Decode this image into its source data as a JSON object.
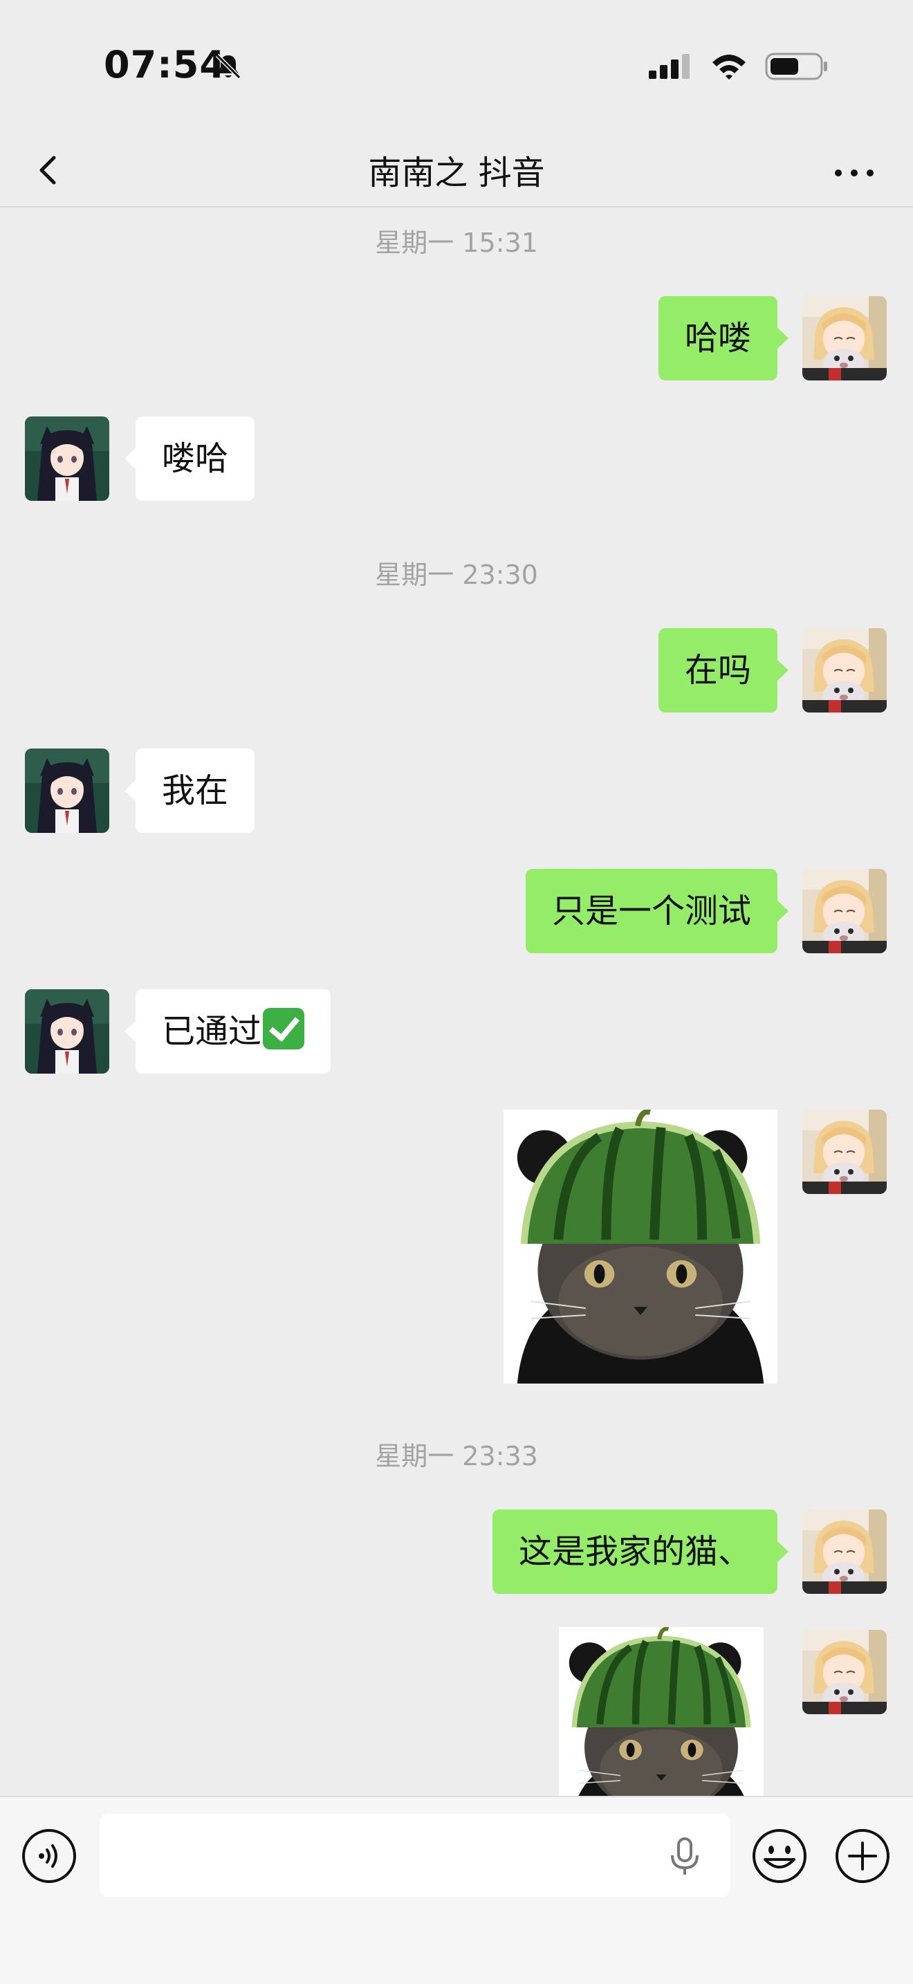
{
  "status_bar": {
    "time": "07:54",
    "icons": [
      "bell-slash-icon",
      "cellular-signal-icon",
      "wifi-icon",
      "battery-icon"
    ]
  },
  "nav": {
    "title": "南南之 抖音",
    "back_icon": "chevron-left-icon",
    "more_icon": "ellipsis-icon"
  },
  "messages": {
    "ts1": "星期一 15:31",
    "m1": "哈喽",
    "m2": "喽哈",
    "ts2": "星期一 23:30",
    "m3": "在吗",
    "m4": "我在",
    "m5": "只是一个测试",
    "m6": "已通过",
    "m6_emoji": "check-mark-button-emoji",
    "ts3": "星期一 23:33",
    "m7": "这是我家的猫、",
    "sticker_desc": "cat-wearing-watermelon-helmet-sticker"
  },
  "input_bar": {
    "voice_icon": "voice-mode-icon",
    "mic_icon": "microphone-icon",
    "emoji_icon": "smiley-face-icon",
    "plus_icon": "plus-circle-icon"
  },
  "colors": {
    "background": "#ededed",
    "my_bubble": "#95ec69",
    "other_bubble": "#ffffff",
    "timestamp_text": "#a3a3a3"
  }
}
